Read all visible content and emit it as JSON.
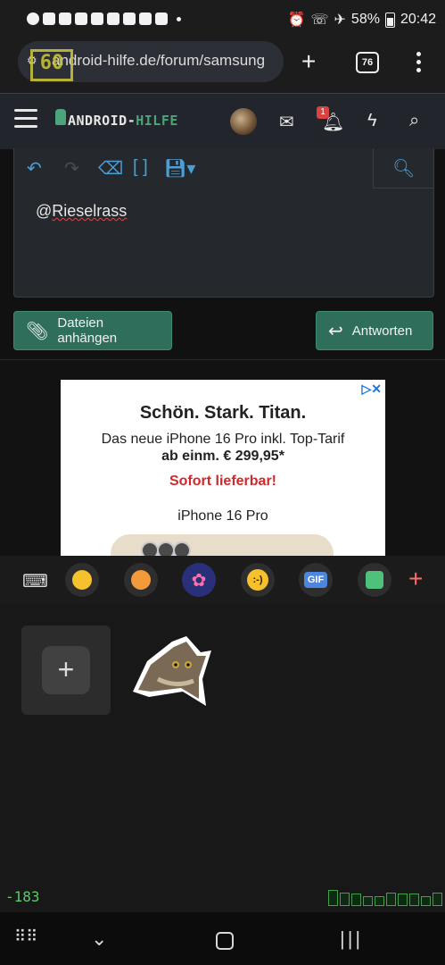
{
  "status_bar": {
    "battery": "58%",
    "time": "20:42"
  },
  "browser": {
    "url": "android-hilfe.de/forum/samsung",
    "overlay_badge": "60",
    "tab_count": "76"
  },
  "site_header": {
    "logo_part1": "ANDROID-",
    "logo_part2": "HILFE",
    "notification_count": "1",
    "icons": [
      "menu-icon",
      "avatar",
      "mail-icon",
      "bell-icon",
      "lightning-icon",
      "search-icon"
    ]
  },
  "editor": {
    "toolbar": [
      "undo-icon",
      "redo-icon",
      "eraser-icon",
      "brackets-icon",
      "save-icon",
      "preview-icon"
    ],
    "content_prefix": "@",
    "content_word": "Rieselrass"
  },
  "actions": {
    "attach_label": "Dateien anhängen",
    "reply_label": "Antworten"
  },
  "ad": {
    "title": "Schön. Stark. Titan.",
    "subtitle": "Das neue iPhone 16 Pro inkl. Top-Tarif",
    "price": "ab einm. € 299,95*",
    "cta": "Sofort lieferbar!",
    "brand": "iPhone 16 Pro"
  },
  "keyboard": {
    "toolbar_items": [
      "keyboard-icon",
      "emoji-icon",
      "emoji-sticker-icon",
      "bitmoji-icon",
      "emoticon-icon",
      "gif-icon",
      "sticker-icon",
      "plus-icon"
    ],
    "emoticon_text": ":-)",
    "gif_text": "GIF",
    "debug_value": "-183",
    "debug_bars": [
      0.8,
      0.65,
      0.6,
      0.45,
      0.45,
      0.65,
      0.6,
      0.6,
      0.45,
      0.65
    ]
  },
  "colors": {
    "accent_green": "#2f6e5b",
    "logo_green": "#4aa57a",
    "tool_blue": "#4a9fd6",
    "badge_red": "#d8423f",
    "ad_red": "#d0282b"
  }
}
